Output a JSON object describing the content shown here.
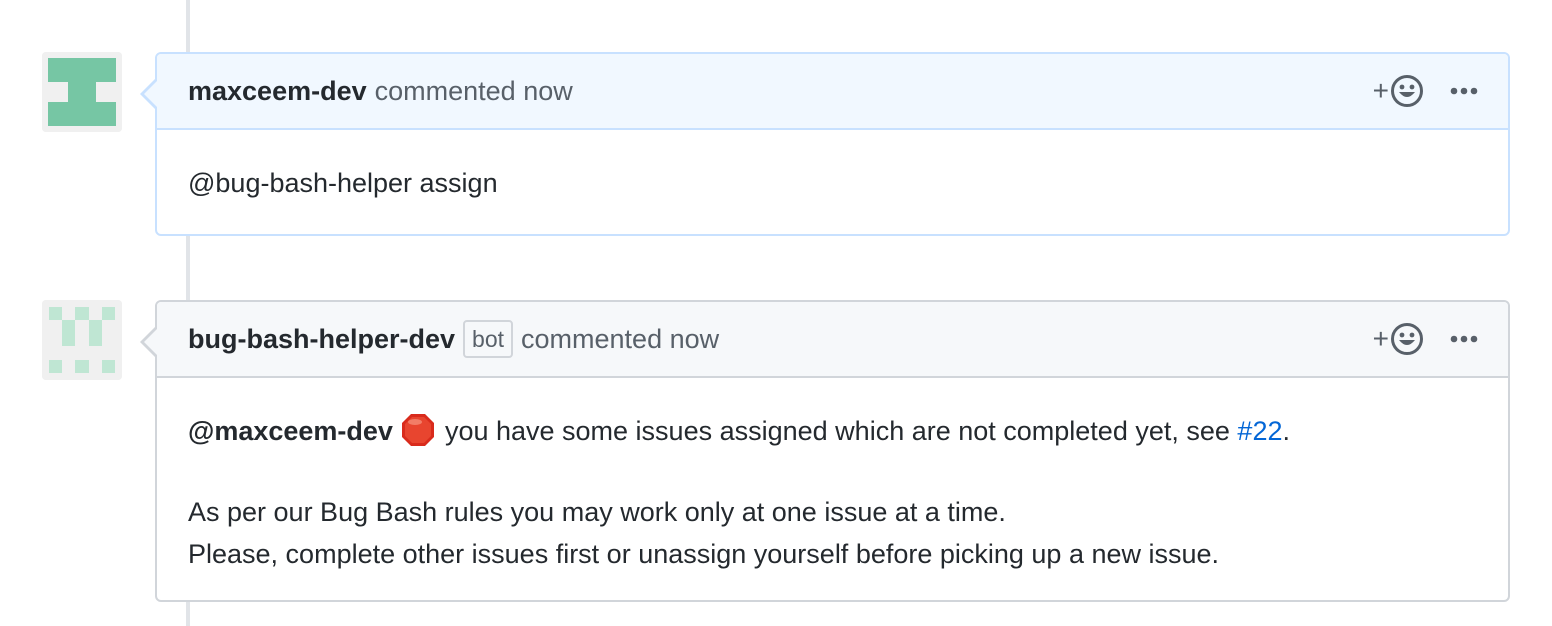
{
  "comments": [
    {
      "author": "maxceem-dev",
      "meta": "commented now",
      "body": "@bug-bash-helper assign",
      "reaction_plus": "+",
      "avatar_icon": "identicon-green",
      "accent": "#c8e1ff"
    },
    {
      "author": "bug-bash-helper-dev",
      "badge": "bot",
      "meta": "commented now",
      "reaction_plus": "+",
      "avatar_icon": "identicon-light-green",
      "mention": "@maxceem-dev",
      "status_icon": "stop-sign-icon",
      "line1": "you have some issues assigned which are not completed yet, see",
      "issue_ref": "#22",
      "line1_end": ".",
      "line2": "As per our Bug Bash rules you may work only at one issue at a time.",
      "line3": "Please, complete other issues first or unassign yourself before picking up a new issue.",
      "accent": "#d1d5da"
    }
  ],
  "colors": {
    "link": "#0366d6",
    "text": "#24292e",
    "muted": "#586069",
    "timeline": "#e1e4e8"
  }
}
